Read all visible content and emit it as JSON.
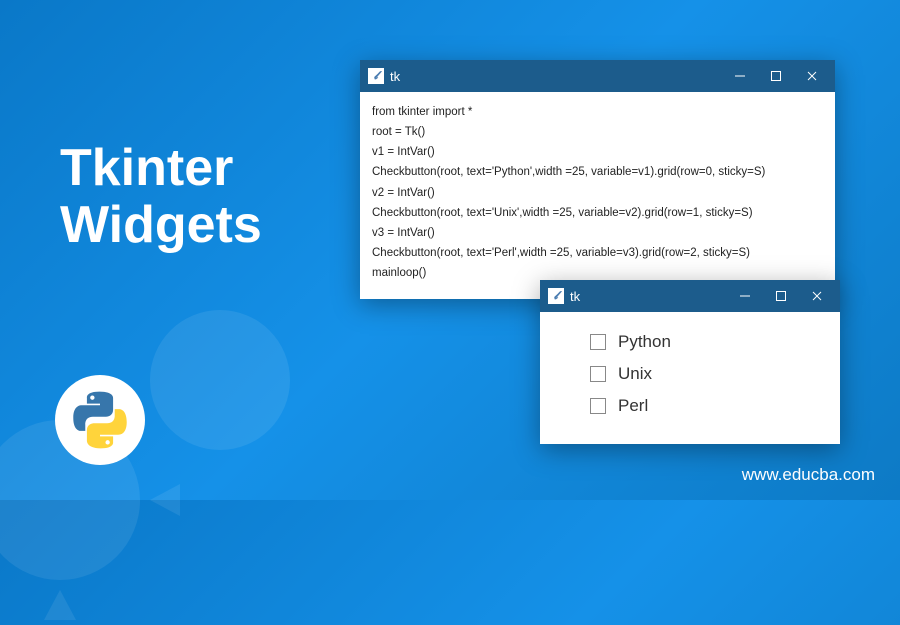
{
  "headline": {
    "line1": "Tkinter",
    "line2": "Widgets"
  },
  "watermark": "www.educba.com",
  "window1": {
    "title": "tk",
    "code": "from tkinter import *\nroot = Tk()\nv1 = IntVar()\nCheckbutton(root, text='Python',width =25, variable=v1).grid(row=0, sticky=S)\nv2 = IntVar()\nCheckbutton(root, text='Unix',width =25, variable=v2).grid(row=1, sticky=S)\nv3 = IntVar()\nCheckbutton(root, text='Perl',width =25, variable=v3).grid(row=2, sticky=S)\nmainloop()"
  },
  "window2": {
    "title": "tk",
    "items": [
      "Python",
      "Unix",
      "Perl"
    ]
  }
}
